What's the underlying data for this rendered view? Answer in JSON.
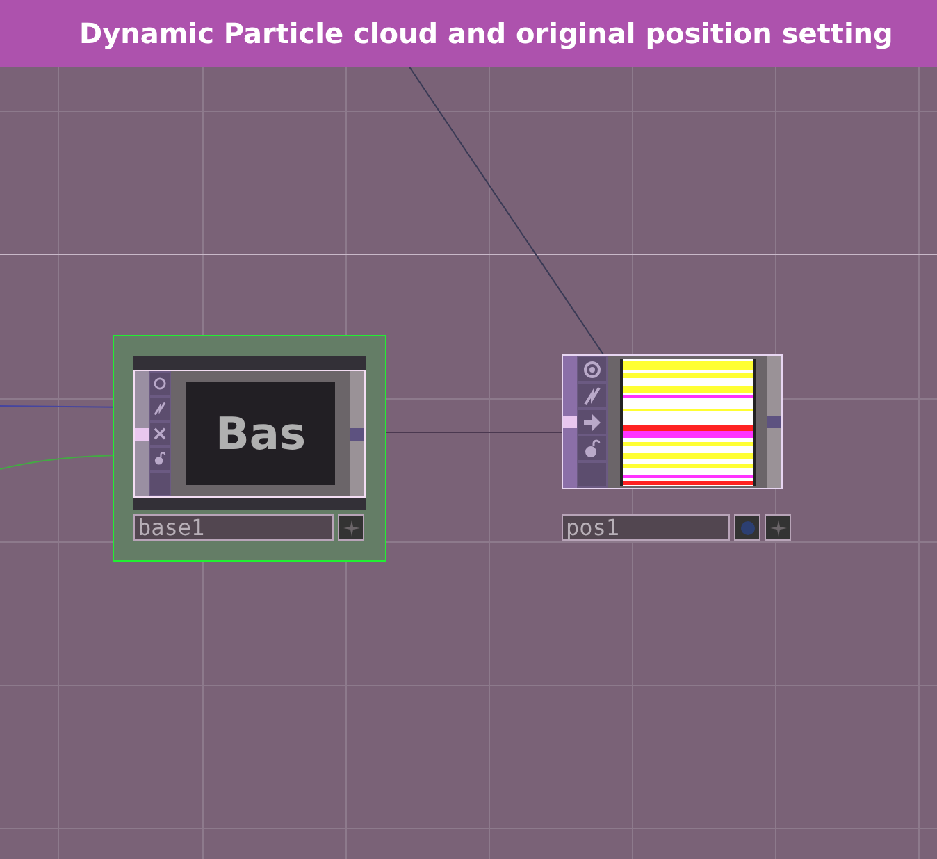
{
  "title": "Dynamic Particle cloud and original position setting",
  "nodes": [
    {
      "kind": "base",
      "name": "base1",
      "preview_text": "Bas",
      "selected": true
    },
    {
      "kind": "top",
      "name": "pos1",
      "selected": false
    }
  ]
}
